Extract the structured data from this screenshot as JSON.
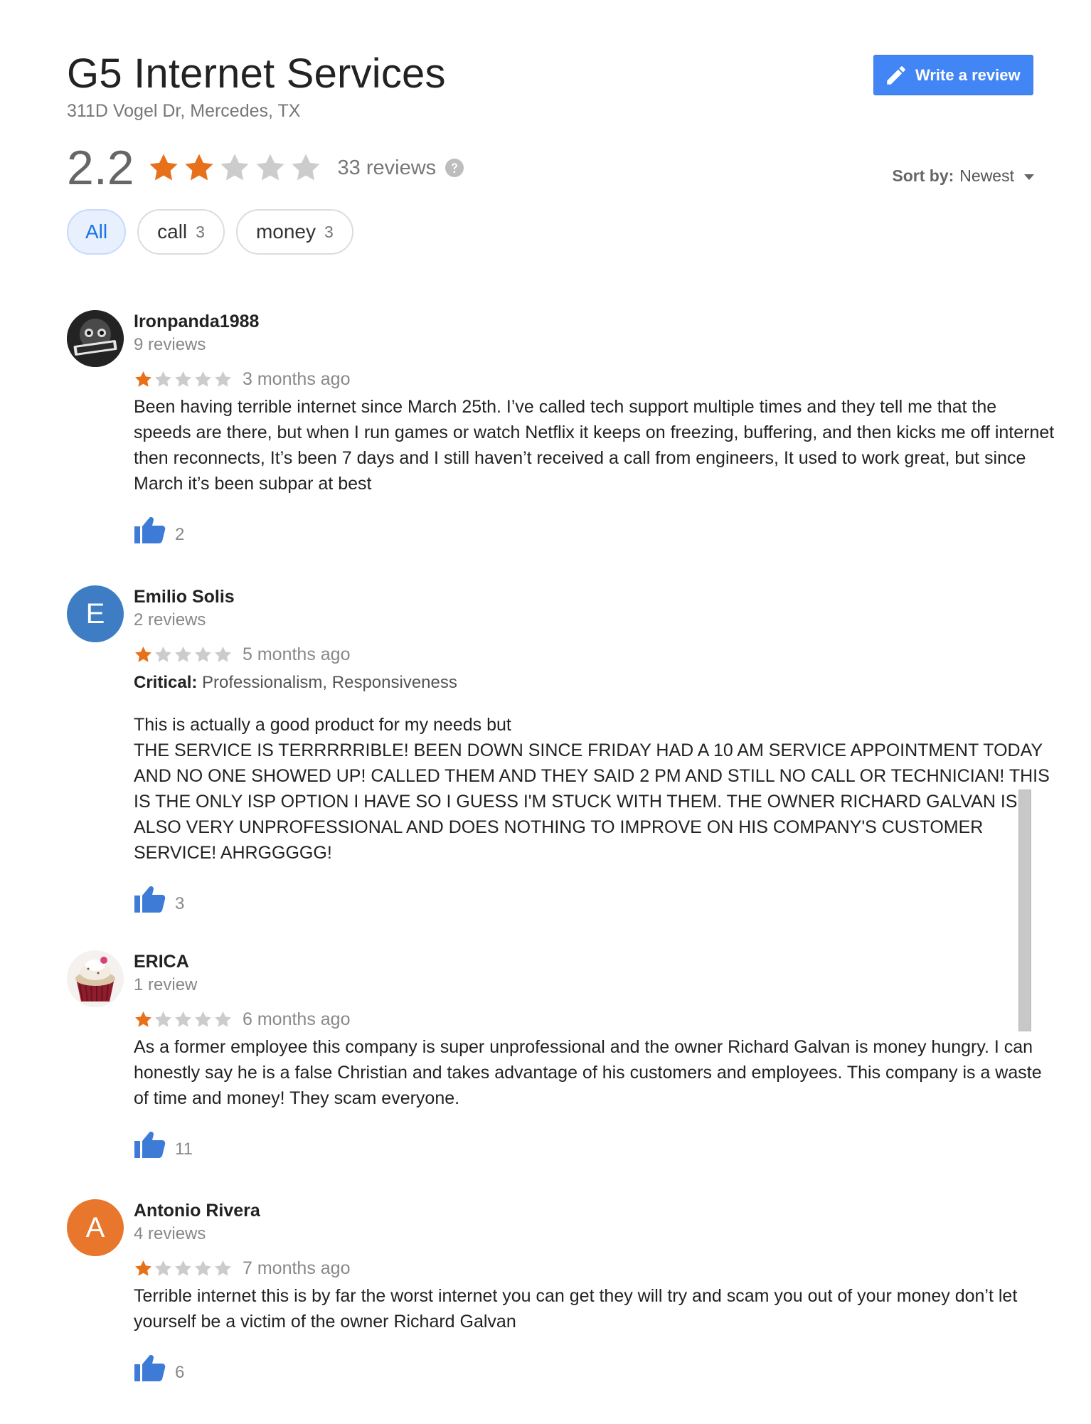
{
  "business": {
    "name": "G5 Internet Services",
    "address": "311D Vogel Dr, Mercedes, TX"
  },
  "write_review_label": "Write a review",
  "rating": {
    "value": "2.2",
    "stars": 2,
    "max_stars": 5,
    "reviews_label": "33 reviews"
  },
  "sort": {
    "label": "Sort by:",
    "value": "Newest"
  },
  "chips": [
    {
      "label": "All",
      "count": "",
      "active": true
    },
    {
      "label": "call",
      "count": "3",
      "active": false
    },
    {
      "label": "money",
      "count": "3",
      "active": false
    }
  ],
  "colors": {
    "star_filled": "#e7711b",
    "star_empty": "#cccccc",
    "accent": "#4285f4",
    "like": "#3e7bd6"
  },
  "reviews": [
    {
      "name": "Ironpanda1988",
      "review_count": "9 reviews",
      "stars": 1,
      "time": "3 months ago",
      "critical_label": "",
      "critical_values": "",
      "text": "Been having terrible internet since March 25th. I’ve called tech support multiple times and they tell me that the speeds are there, but when I run games or watch Netflix it keeps on freezing, buffering, and then kicks me off internet then reconnects,   It’s been 7 days and I still haven’t received a call from engineers, It used to work great, but since March it’s been subpar at best",
      "likes": "2",
      "avatar": {
        "type": "image",
        "icon": "panda-logo-avatar",
        "letter": ""
      }
    },
    {
      "name": "Emilio Solis",
      "review_count": "2 reviews",
      "stars": 1,
      "time": "5 months ago",
      "critical_label": "Critical:",
      "critical_values": "Professionalism, Responsiveness",
      "text": "This is actually a good product for my needs but\nTHE SERVICE IS TERRRRRIBLE! BEEN DOWN SINCE FRIDAY HAD A 10 AM SERVICE APPOINTMENT TODAY AND NO ONE SHOWED UP! CALLED THEM AND THEY SAID 2 PM AND STILL NO CALL OR TECHNICIAN! THIS IS THE ONLY ISP OPTION I HAVE SO I GUESS I'M STUCK WITH THEM. THE OWNER RICHARD GALVAN IS ALSO VERY UNPROFESSIONAL AND DOES NOTHING TO IMPROVE ON HIS COMPANY'S CUSTOMER SERVICE! AHRGGGGG!",
      "likes": "3",
      "avatar": {
        "type": "letter",
        "icon": "letter-avatar",
        "letter": "E"
      }
    },
    {
      "name": "ERICA",
      "review_count": "1 review",
      "stars": 1,
      "time": "6 months ago",
      "critical_label": "",
      "critical_values": "",
      "text": "As a former employee this company is super unprofessional and the owner Richard Galvan is money hungry. I can honestly say he is a false Christian and takes advantage of his customers and employees. This company is a waste of time and money! They scam everyone.",
      "likes": "11",
      "avatar": {
        "type": "image",
        "icon": "cupcake-avatar",
        "letter": ""
      }
    },
    {
      "name": "Antonio Rivera",
      "review_count": "4 reviews",
      "stars": 1,
      "time": "7 months ago",
      "critical_label": "",
      "critical_values": "",
      "text": "Terrible internet this is by far the worst internet you can get they will try and scam you out of your money don’t let yourself be a victim of the owner Richard Galvan",
      "likes": "6",
      "avatar": {
        "type": "letter",
        "icon": "letter-avatar",
        "letter": "A"
      }
    }
  ]
}
